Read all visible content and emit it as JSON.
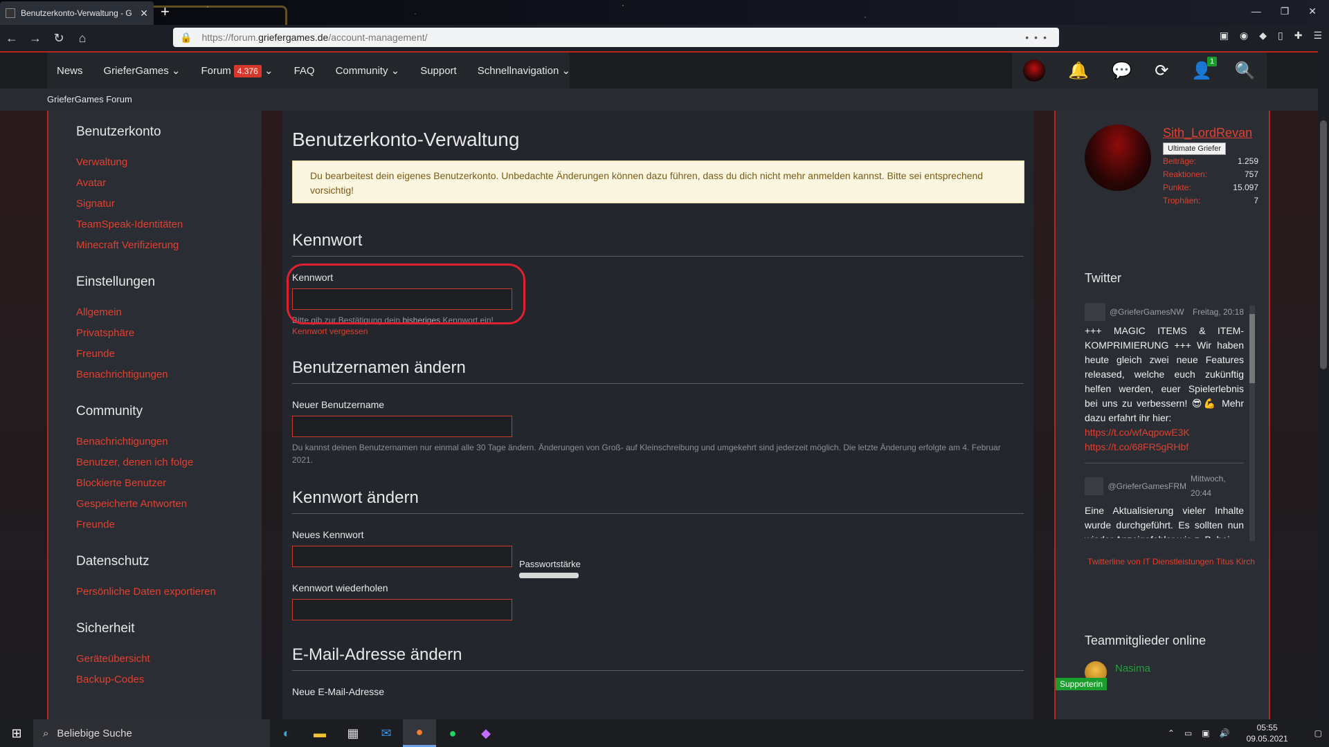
{
  "browser": {
    "tab_title": "Benutzerkonto-Verwaltung - G",
    "url_prefix": "https://forum.",
    "url_domain": "griefergames.de",
    "url_path": "/account-management/",
    "url_menu": "•••"
  },
  "site": {
    "menu": [
      {
        "label": "News"
      },
      {
        "label": "GrieferGames ⌄"
      },
      {
        "label": "Forum",
        "badge": "4.376",
        "suffix": " ⌄"
      },
      {
        "label": "FAQ"
      },
      {
        "label": "Community ⌄"
      },
      {
        "label": "Support"
      },
      {
        "label": "Schnellnavigation ⌄"
      }
    ],
    "notification_count": "1",
    "breadcrumb": "GrieferGames Forum"
  },
  "sidebar_left": {
    "sections": [
      {
        "title": "Benutzerkonto",
        "links": [
          "Verwaltung",
          "Avatar",
          "Signatur",
          "TeamSpeak-Identitäten",
          "Minecraft Verifizierung"
        ]
      },
      {
        "title": "Einstellungen",
        "links": [
          "Allgemein",
          "Privatsphäre",
          "Freunde",
          "Benachrichtigungen"
        ]
      },
      {
        "title": "Community",
        "links": [
          "Benachrichtigungen",
          "Benutzer, denen ich folge",
          "Blockierte Benutzer",
          "Gespeicherte Antworten",
          "Freunde"
        ]
      },
      {
        "title": "Datenschutz",
        "links": [
          "Persönliche Daten exportieren"
        ]
      },
      {
        "title": "Sicherheit",
        "links": [
          "Geräteübersicht",
          "Backup-Codes"
        ]
      }
    ]
  },
  "main": {
    "title": "Benutzerkonto-Verwaltung",
    "notice": "Du bearbeitest dein eigenes Benutzerkonto. Unbedachte Änderungen können dazu führen, dass du dich nicht mehr anmelden kannst. Bitte sei entsprechend vorsichtig!",
    "password_section": {
      "title": "Kennwort",
      "label": "Kennwort",
      "hint_pre": "Bitte gib zur Bestätigung dein ",
      "hint_u": "bisheriges",
      "hint_post": " Kennwort ein!",
      "forgot": "Kennwort vergessen"
    },
    "username_section": {
      "title": "Benutzernamen ändern",
      "label": "Neuer Benutzername",
      "hint": "Du kannst deinen Benutzernamen nur einmal alle 30 Tage ändern. Änderungen von Groß- auf Kleinschreibung und umgekehrt sind jederzeit möglich. Die letzte Änderung erfolgte am 4. Februar 2021."
    },
    "change_password_section": {
      "title": "Kennwort ändern",
      "new_label": "Neues Kennwort",
      "strength_label": "Passwortstärke",
      "repeat_label": "Kennwort wiederholen"
    },
    "email_section": {
      "title": "E-Mail-Adresse ändern",
      "label": "Neue E-Mail-Adresse"
    }
  },
  "sidebar_right": {
    "user": {
      "name": "Sith_LordRevan",
      "rank": "Ultimate Griefer",
      "stats": [
        {
          "key": "Beiträge:",
          "value": "1.259"
        },
        {
          "key": "Reaktionen:",
          "value": "757"
        },
        {
          "key": "Punkte:",
          "value": "15.097"
        },
        {
          "key": "Trophäen:",
          "value": "7"
        }
      ]
    },
    "twitter": {
      "title": "Twitter",
      "tweets": [
        {
          "handle": "@GrieferGamesNW",
          "time": "Freitag, 20:18",
          "text": "+++ MAGIC ITEMS & ITEM-KOMPRIMIERUNG +++ Wir haben heute gleich zwei neue Features released, welche euch zukünftig helfen werden, euer Spielerlebnis bei uns zu verbessern! 😎💪 Mehr dazu erfahrt ihr hier:",
          "links": [
            "https://t.co/wfAqpowE3K",
            "https://t.co/68FR5gRHbf"
          ]
        },
        {
          "handle": "@GrieferGamesFRM",
          "time": "Mittwoch, 20:44",
          "text": "Eine Aktualisierung vieler Inhalte wurde durchgeführt. Es sollten nun wieder Anzeigefehler wie z. B. bei",
          "links": []
        }
      ],
      "footer": "Twitterline von IT Dienstleistungen Titus Kirch"
    },
    "team": {
      "title": "Teammitglieder online",
      "member_name": "Nasima",
      "member_role": "Supporterin"
    }
  },
  "taskbar": {
    "search_placeholder": "Beliebige Suche",
    "time": "05:55",
    "date": "09.05.2021"
  }
}
